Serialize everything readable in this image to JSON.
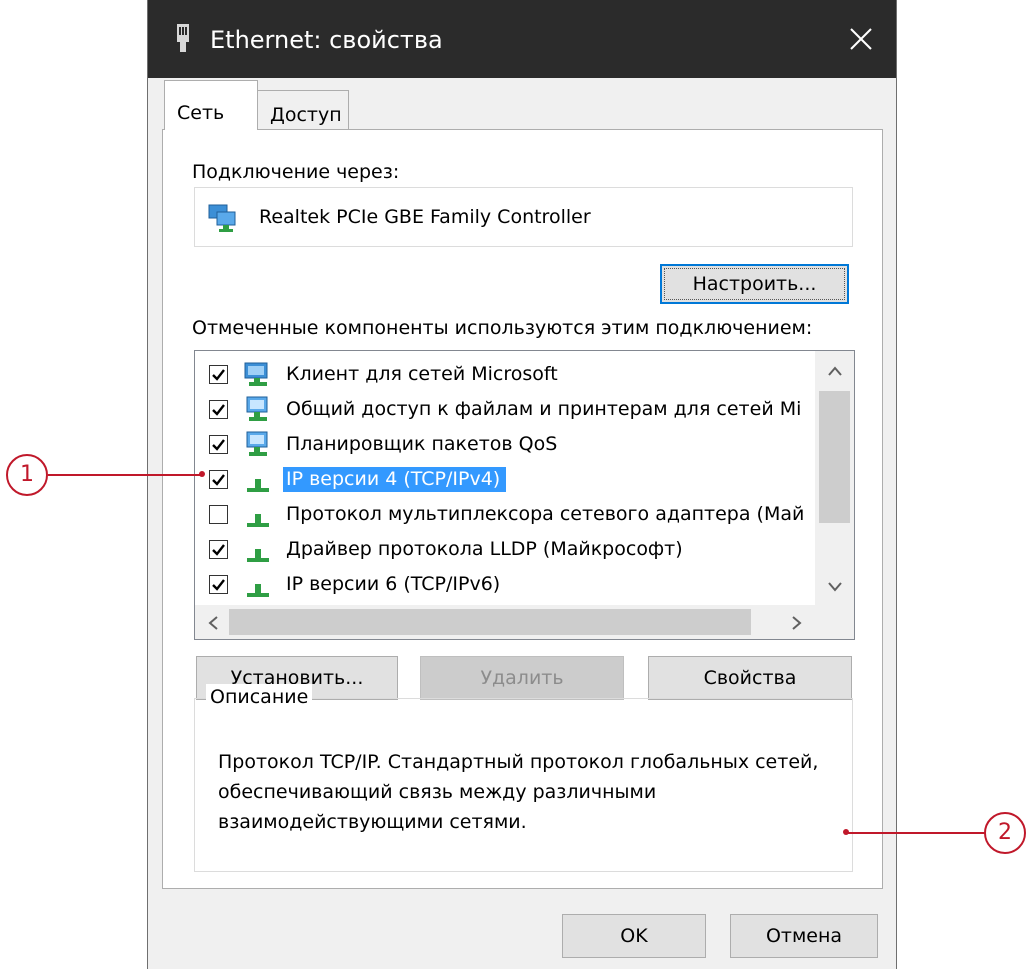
{
  "window": {
    "title": "Ethernet: свойства",
    "colors": {
      "titlebar": "#2b2b2b",
      "accent": "#0078d7",
      "selection": "#3399ff",
      "callout": "#c0182a"
    }
  },
  "tabs": [
    {
      "label": "Сеть",
      "active": true
    },
    {
      "label": "Доступ",
      "active": false
    }
  ],
  "connection": {
    "label": "Подключение через:",
    "adapter_name": "Realtek PCIe GBE Family Controller",
    "adapter_icon": "network-adapter-icon",
    "configure_button": "Настроить..."
  },
  "components": {
    "label": "Отмеченные компоненты используются этим подключением:",
    "items": [
      {
        "label": "Клиент для сетей Microsoft",
        "checked": true,
        "icon": "network-client-icon",
        "selected": false
      },
      {
        "label": "Общий доступ к файлам и принтерам для сетей Mi",
        "checked": true,
        "icon": "network-service-icon",
        "selected": false
      },
      {
        "label": "Планировщик пакетов QoS",
        "checked": true,
        "icon": "network-service-icon",
        "selected": false
      },
      {
        "label": "IP версии 4 (TCP/IPv4)",
        "checked": true,
        "icon": "protocol-icon",
        "selected": true
      },
      {
        "label": "Протокол мультиплексора сетевого адаптера (Май",
        "checked": false,
        "icon": "protocol-icon",
        "selected": false
      },
      {
        "label": "Драйвер протокола LLDP (Майкрософт)",
        "checked": true,
        "icon": "protocol-icon",
        "selected": false
      },
      {
        "label": "IP версии 6 (TCP/IPv6)",
        "checked": true,
        "icon": "protocol-icon",
        "selected": false
      }
    ]
  },
  "buttons": {
    "install": "Установить...",
    "remove": "Удалить",
    "properties": "Свойства",
    "ok": "OK",
    "cancel": "Отмена"
  },
  "description": {
    "legend": "Описание",
    "text": "Протокол TCP/IP. Стандартный протокол глобальных сетей, обеспечивающий связь между различными взаимодействующими сетями."
  },
  "callouts": [
    {
      "number": "1"
    },
    {
      "number": "2"
    }
  ]
}
